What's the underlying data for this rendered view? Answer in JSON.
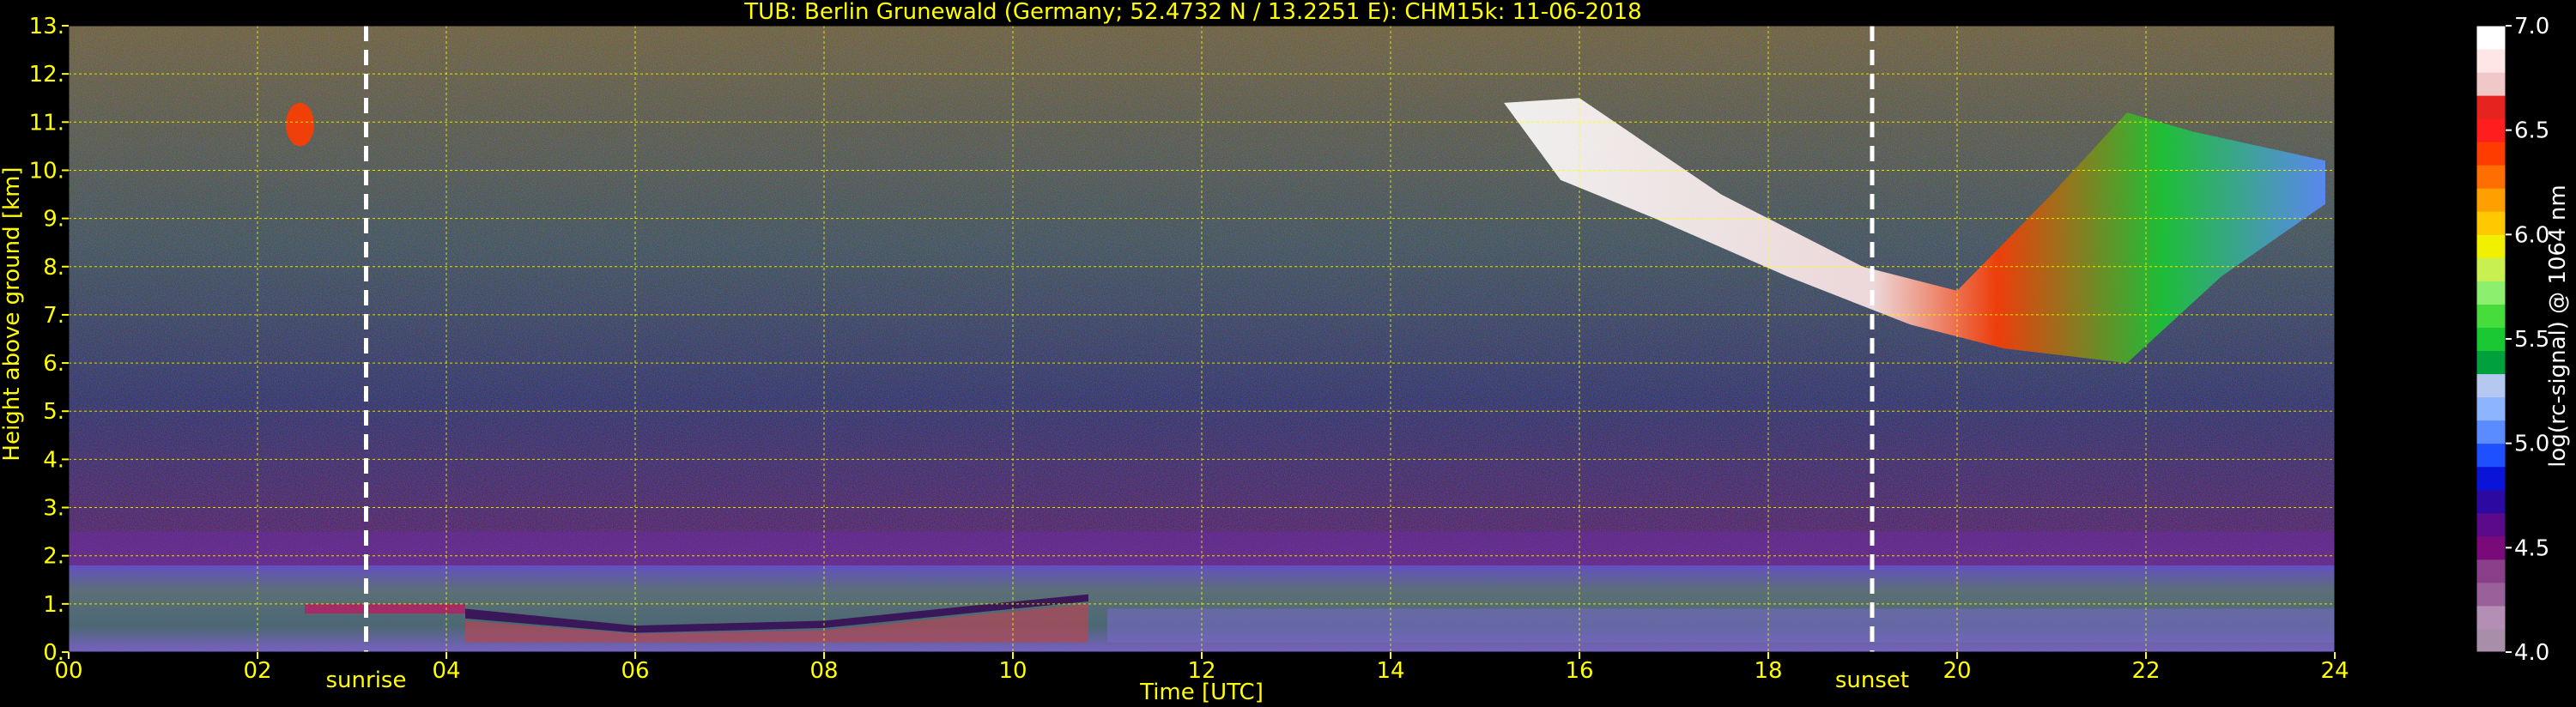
{
  "colors": {
    "background": "#000000",
    "text": "#ffff00",
    "colorbar_text": "#ffffff",
    "grid": "#ffff00",
    "event_line": "#ffffff"
  },
  "chart_data": {
    "type": "heatmap",
    "title": "TUB: Berlin Grunewald (Germany; 52.4732 N / 13.2251 E):    CHM15k: 11-06-2018",
    "xlabel": "Time [UTC]",
    "ylabel": "Height above ground [km]",
    "xlim": [
      0,
      24
    ],
    "ylim": [
      0,
      13
    ],
    "x_ticks": [
      0,
      2,
      4,
      6,
      8,
      10,
      12,
      14,
      16,
      18,
      20,
      22,
      24
    ],
    "x_tick_labels": [
      "00",
      "02",
      "04",
      "06",
      "08",
      "10",
      "12",
      "14",
      "16",
      "18",
      "20",
      "22",
      "24"
    ],
    "y_ticks": [
      0,
      1,
      2,
      3,
      4,
      5,
      6,
      7,
      8,
      9,
      10,
      11,
      12,
      13
    ],
    "y_tick_labels": [
      "0.",
      "1.",
      "2.",
      "3.",
      "4.",
      "5.",
      "6.",
      "7.",
      "8.",
      "9.",
      "10.",
      "11.",
      "12.",
      "13."
    ],
    "grid": true,
    "annotations": [
      {
        "label": "sunrise",
        "time": 3.15
      },
      {
        "label": "sunset",
        "time": 19.1
      }
    ],
    "colorbar": {
      "label": "log(rc-signal) @ 1064 nm",
      "range": [
        4.0,
        7.0
      ],
      "ticks": [
        4.0,
        4.5,
        5.0,
        5.5,
        6.0,
        6.5,
        7.0
      ],
      "tick_labels": [
        "4.0",
        "4.5",
        "5.0",
        "5.5",
        "6.0",
        "6.5",
        "7.0"
      ],
      "colors": [
        "#a88ea8",
        "#b48eb4",
        "#9a609a",
        "#8a3f8a",
        "#7a0a7a",
        "#5a0a8a",
        "#2a0aa0",
        "#0a14d8",
        "#1e50ff",
        "#5a8cff",
        "#8cb4ff",
        "#b4c8f0",
        "#00a03c",
        "#19c832",
        "#46dc3c",
        "#8cf06e",
        "#c8f050",
        "#f0f000",
        "#ffc800",
        "#ffa000",
        "#ff6e00",
        "#ff3c00",
        "#ff1e1e",
        "#e6231e",
        "#f0c8c8",
        "#ffe6e6",
        "#ffffff"
      ]
    },
    "layers": [
      {
        "name": "boundary layer",
        "start": 0,
        "end": 24,
        "top_km": 1.8
      },
      {
        "name": "residual layer",
        "start": 0,
        "end": 24,
        "top_km": 2.5
      },
      {
        "name": "night cloud patch",
        "start": 2.3,
        "end": 2.6,
        "base_km": 10.5,
        "top_km": 11.4
      },
      {
        "name": "cirrus band",
        "start": 15.2,
        "end": 23.9,
        "base_km": 6.0,
        "top_km": 11.5
      }
    ]
  }
}
